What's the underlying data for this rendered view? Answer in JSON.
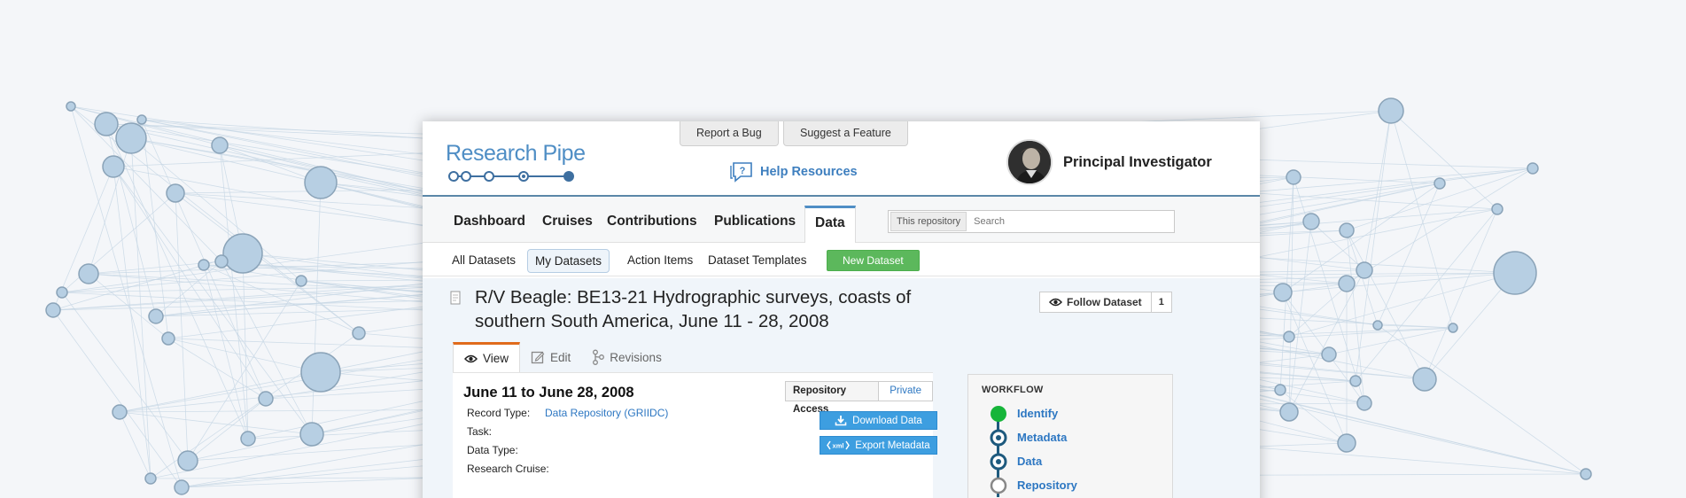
{
  "top_buttons": {
    "report_bug": "Report a Bug",
    "suggest_feature": "Suggest a Feature"
  },
  "logo": {
    "text": "Research Pipe"
  },
  "help": {
    "label": "Help Resources"
  },
  "user": {
    "name": "Principal Investigator"
  },
  "nav": {
    "items": [
      "Dashboard",
      "Cruises",
      "Contributions",
      "Publications",
      "Data"
    ],
    "active": "Data"
  },
  "search": {
    "scope": "This repository",
    "placeholder": "Search"
  },
  "subnav": {
    "items": [
      "All Datasets",
      "My Datasets",
      "Action Items",
      "Dataset Templates"
    ],
    "active": "My Datasets",
    "new_button": "New Dataset"
  },
  "dataset": {
    "title": "R/V Beagle: BE13-21 Hydrographic surveys, coasts of southern South America, June 11 - 28, 2008",
    "follow_label": "Follow Dataset",
    "follow_count": "1",
    "tabs": [
      "View",
      "Edit",
      "Revisions"
    ],
    "active_tab": "View",
    "date_range": "June 11 to June 28, 2008",
    "fields": {
      "record_type_label": "Record Type:",
      "record_type_value": "Data Repository (GRIIDC)",
      "task_label": "Task:",
      "data_type_label": "Data Type:",
      "research_cruise_label": "Research Cruise:"
    },
    "access_label": "Repository Access",
    "access_value": "Private",
    "download_button": "Download Data",
    "export_button": "Export Metadata",
    "xml_tag": "xml"
  },
  "workflow": {
    "title": "WORKFLOW",
    "steps": [
      {
        "label": "Identify",
        "state": "complete"
      },
      {
        "label": "Metadata",
        "state": "current"
      },
      {
        "label": "Data",
        "state": "current"
      },
      {
        "label": "Repository",
        "state": "pending"
      }
    ]
  },
  "colors": {
    "brand_blue": "#4f8ec5",
    "link_blue": "#2d77c2",
    "green": "#5cb85c",
    "orange_tab": "#e06b1c",
    "workflow_dark": "#1e5a7e",
    "workflow_complete": "#16b53a"
  }
}
